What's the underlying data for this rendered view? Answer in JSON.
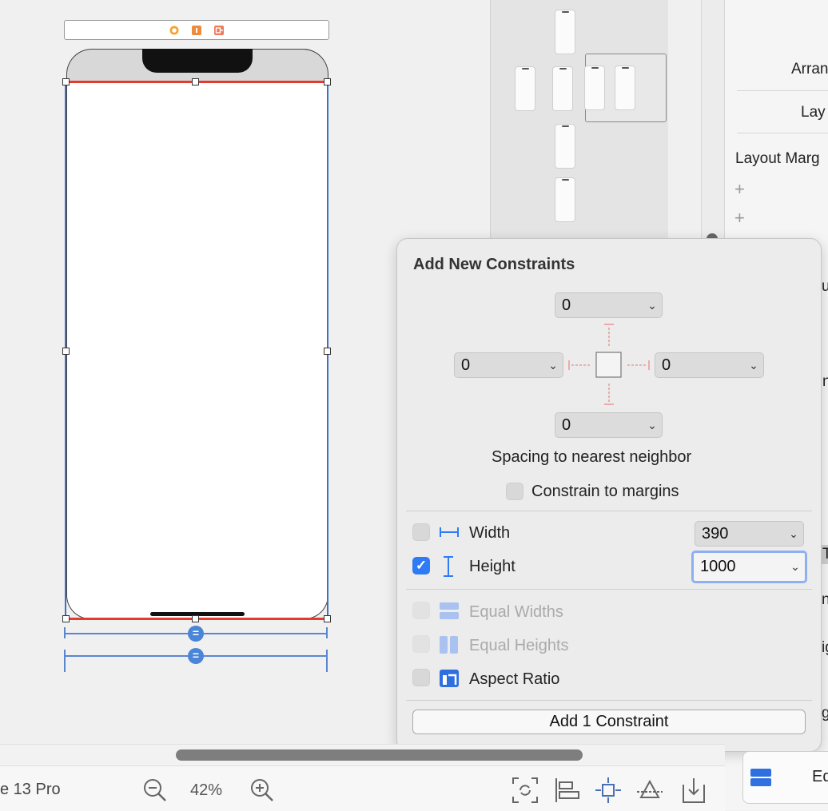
{
  "popover": {
    "title": "Add New Constraints",
    "spacing": {
      "top": "0",
      "left": "0",
      "right": "0",
      "bottom": "0"
    },
    "spacing_label": "Spacing to nearest neighbor",
    "constrain_margins_label": "Constrain to margins",
    "width": {
      "label": "Width",
      "value": "390",
      "checked": false
    },
    "height": {
      "label": "Height",
      "value": "1000",
      "checked": true
    },
    "equal_widths_label": "Equal Widths",
    "equal_heights_label": "Equal Heights",
    "aspect_ratio_label": "Aspect Ratio",
    "add_button_label": "Add 1 Constraint"
  },
  "inspector": {
    "arrange_label": "Arran",
    "layout_label": "Lay",
    "layout_margins_label": "Layout Marg",
    "partial_u": "u",
    "partial_nt": "nt",
    "partial_t": "T",
    "partial_n": "n",
    "partial_ig": "ig",
    "partial_g": "g",
    "editor_label": "Ed"
  },
  "bottom_bar": {
    "device_label": "e 13 Pro",
    "zoom_level": "42%"
  },
  "colors": {
    "selection_blue": "#3f6fc8",
    "constraint_red": "#e63a2e",
    "checkbox_blue": "#2f7bf6",
    "focus_ring": "#8fb0f0"
  }
}
